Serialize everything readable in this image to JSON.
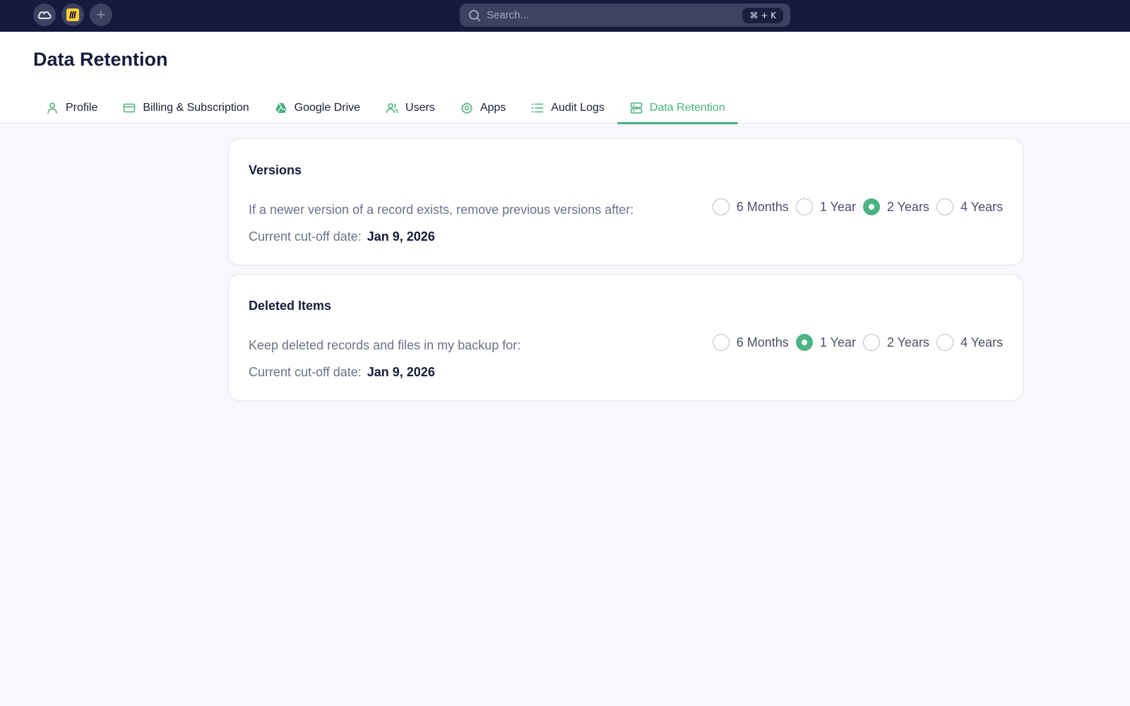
{
  "topbar": {
    "search_placeholder": "Search...",
    "shortcut": "⌘ + K"
  },
  "header": {
    "title": "Data Retention"
  },
  "tabs": [
    {
      "label": "Profile",
      "icon": "user-icon"
    },
    {
      "label": "Billing & Subscription",
      "icon": "credit-card-icon"
    },
    {
      "label": "Google Drive",
      "icon": "google-drive-icon"
    },
    {
      "label": "Users",
      "icon": "users-icon"
    },
    {
      "label": "Apps",
      "icon": "gear-icon"
    },
    {
      "label": "Audit Logs",
      "icon": "list-icon"
    },
    {
      "label": "Data Retention",
      "icon": "server-icon",
      "active": true
    }
  ],
  "versions": {
    "title": "Versions",
    "description": "If a newer version of a record exists, remove previous versions after:",
    "cutoff_label": "Current cut-off date:",
    "cutoff_date": "Jan 9, 2026",
    "options": [
      "6 Months",
      "1 Year",
      "2 Years",
      "4 Years"
    ],
    "selected": "2 Years"
  },
  "deleted": {
    "title": "Deleted Items",
    "description": "Keep deleted records and files in my backup for:",
    "cutoff_label": "Current cut-off date:",
    "cutoff_date": "Jan 9, 2026",
    "options": [
      "6 Months",
      "1 Year",
      "2 Years",
      "4 Years"
    ],
    "selected": "1 Year"
  },
  "colors": {
    "accent": "#48b07f",
    "topbar": "#151b3d"
  }
}
